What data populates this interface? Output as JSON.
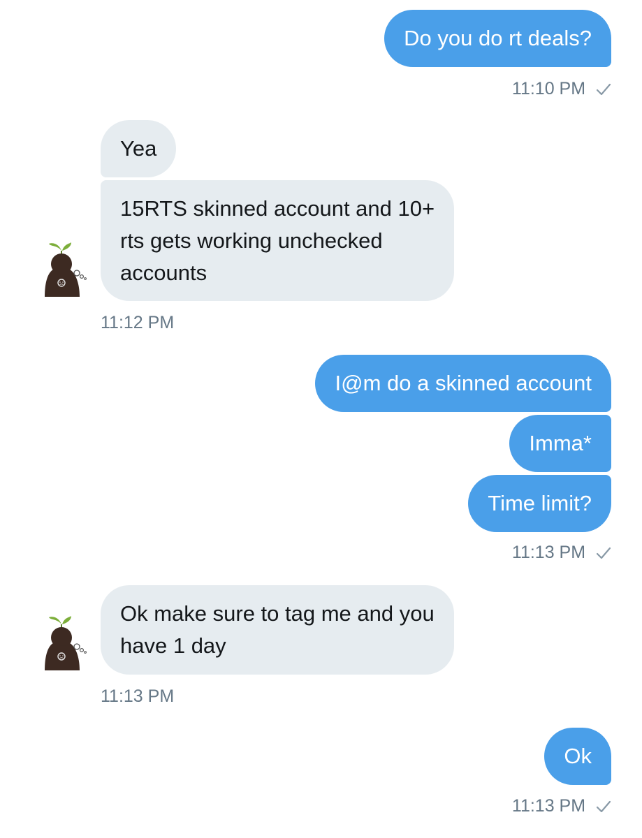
{
  "conversation": {
    "messages": [
      {
        "from": "me",
        "text": "Do you do rt deals?"
      },
      {
        "from": "them",
        "text": "Yea"
      },
      {
        "from": "them",
        "lines": [
          "15RTS skinned account and 10+",
          "rts gets working unchecked",
          "accounts"
        ]
      },
      {
        "from": "me",
        "text": "I@m do a skinned account"
      },
      {
        "from": "me",
        "text": "Imma*"
      },
      {
        "from": "me",
        "text": "Time limit?"
      },
      {
        "from": "them",
        "lines": [
          "Ok make sure to tag me and you",
          "have 1 day"
        ]
      },
      {
        "from": "me",
        "text": "Ok"
      }
    ],
    "timestamps": [
      "11:10 PM",
      "11:12 PM",
      "11:13 PM",
      "11:13 PM",
      "11:13 PM"
    ]
  },
  "colors": {
    "sent_bubble": "#4a9fe9",
    "received_bubble": "#e6ecf0",
    "timestamp_text": "#657786",
    "background": "#ffffff"
  },
  "icons": {
    "read_receipt": "check-icon",
    "avatar": "sprout-sad-face-avatar"
  }
}
